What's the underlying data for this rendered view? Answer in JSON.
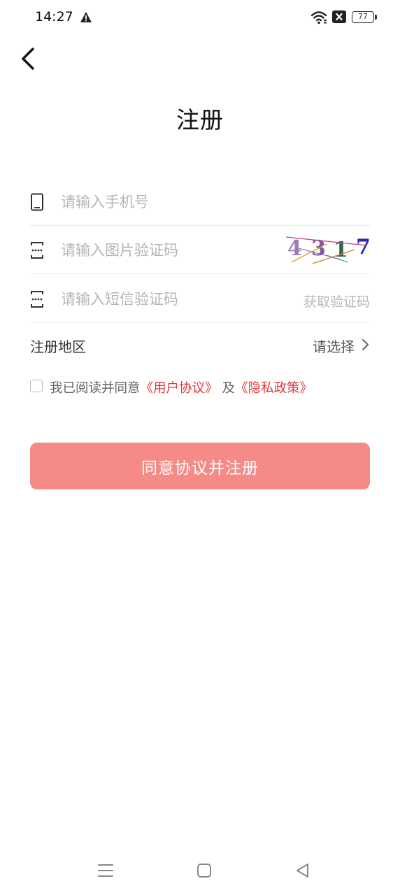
{
  "status_bar": {
    "time": "14:27",
    "battery_level": "77",
    "icons": [
      "warning-icon",
      "wifi-icon",
      "sim-blocked-icon",
      "battery-icon"
    ]
  },
  "header": {
    "back_icon": "chevron-left-icon",
    "title": "注册"
  },
  "form": {
    "phone": {
      "placeholder": "请输入手机号",
      "value": "",
      "icon": "phone-icon"
    },
    "image_code": {
      "placeholder": "请输入图片验证码",
      "value": "",
      "icon": "code-icon",
      "captcha_text": "4317"
    },
    "sms_code": {
      "placeholder": "请输入短信验证码",
      "value": "",
      "icon": "code-icon",
      "get_code_label": "获取验证码"
    },
    "region": {
      "label": "注册地区",
      "value": "请选择"
    }
  },
  "agreement": {
    "checked": false,
    "prefix": "我已阅读并同意",
    "user_agreement": "《用户协议》",
    "and": "及",
    "privacy_policy": "《隐私政策》"
  },
  "submit": {
    "label": "同意协议并注册"
  },
  "colors": {
    "accent": "#f58a87",
    "link": "#e03a3a",
    "placeholder": "#b5b5b5"
  }
}
